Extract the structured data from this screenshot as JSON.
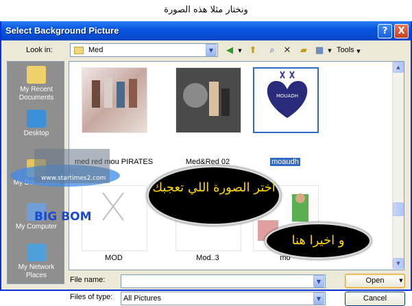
{
  "caption": "ونختار مثلا هذه الصورة",
  "window": {
    "title": "Select Background Picture",
    "help_button": "?",
    "close_button": "X"
  },
  "toolbar": {
    "look_in_label": "Look in:",
    "look_in_value": "Med",
    "tools_label": "Tools"
  },
  "places": [
    {
      "label": "My Recent Documents",
      "icon": "recent-documents-icon"
    },
    {
      "label": "Desktop",
      "icon": "desktop-icon"
    },
    {
      "label": "My Documents",
      "icon": "my-documents-icon"
    },
    {
      "label": "My Computer",
      "icon": "my-computer-icon"
    },
    {
      "label": "My Network Places",
      "icon": "network-places-icon"
    }
  ],
  "files": [
    {
      "name": "med red mou PIRATES",
      "selected": false
    },
    {
      "name": "Med&Red 02",
      "selected": false
    },
    {
      "name": "moaudh",
      "selected": true
    },
    {
      "name": "MOD",
      "selected": false
    },
    {
      "name": "Mod..3",
      "selected": false
    },
    {
      "name": "mo",
      "selected": false
    }
  ],
  "thumb_text": {
    "heart_caption": "MOUADH"
  },
  "watermark": {
    "url": "www.startimes2.com",
    "name": "BIG BOM"
  },
  "annotations": {
    "bubble_1": "اختر الصورة اللي تعجبك",
    "bubble_2": "و اخيرا هنا"
  },
  "form": {
    "file_name_label": "File name:",
    "file_name_value": "",
    "files_of_type_label": "Files of type:",
    "files_of_type_value": "All Pictures",
    "open_button": "Open",
    "cancel_button": "Cancel"
  },
  "colors": {
    "titlebar": "#0a56e0",
    "selection": "#316ac5",
    "bubble_text": "#ffd800",
    "dialog_bg": "#ece9d8"
  }
}
